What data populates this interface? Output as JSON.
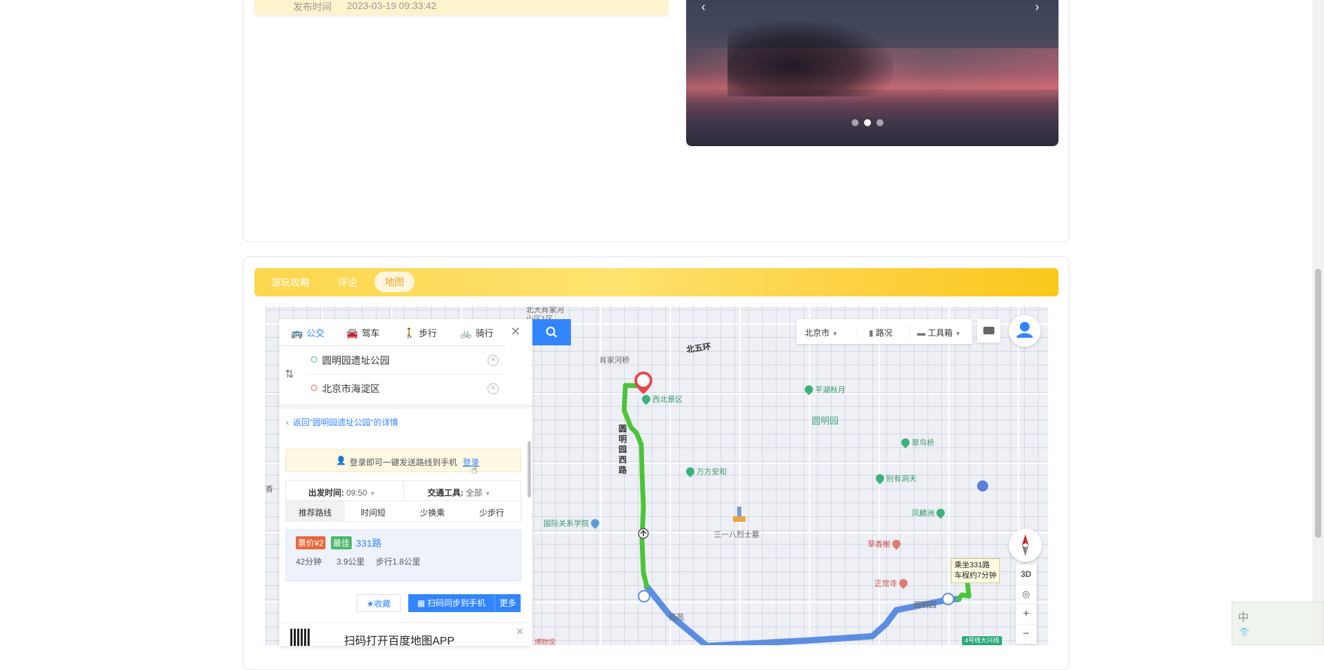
{
  "publish": {
    "label": "发布时间",
    "value": "2023-03-19 09:33:42"
  },
  "carousel": {
    "prev": "‹",
    "next": "›",
    "slide_count": 3,
    "active_slide": 2
  },
  "tabs": [
    {
      "label": "游玩攻略"
    },
    {
      "label": "评论"
    },
    {
      "label": "地图"
    }
  ],
  "active_tab": "地图",
  "map": {
    "modes": [
      {
        "label": "公交",
        "icon": "bus-icon"
      },
      {
        "label": "驾车",
        "icon": "car-icon"
      },
      {
        "label": "步行",
        "icon": "walk-icon"
      },
      {
        "label": "骑行",
        "icon": "bike-icon"
      }
    ],
    "active_mode": "公交",
    "start": "圆明园遗址公园",
    "end": "北京市海淀区",
    "back_link": "返回\"圆明园遗址公园\"的详情",
    "login_hint": "登录即可一键发送路线到手机",
    "login_link": "登录",
    "depart_label": "出发时间:",
    "depart_value": "09:50",
    "vehicle_label": "交通工具:",
    "vehicle_value": "全部",
    "sort_options": [
      "推荐路线",
      "时间短",
      "少换乘",
      "少步行"
    ],
    "plan": {
      "fare": "票价¥2",
      "best": "最佳",
      "route": "331路",
      "duration": "42分钟",
      "distance": "3.9公里",
      "walk": "步行1.8公里"
    },
    "favorite": "收藏",
    "sync": "扫码同步到手机",
    "more": "更多",
    "qr_ad": "扫码打开百度地图APP",
    "toolbar": {
      "city": "北京市",
      "traffic": "路况",
      "tools": "工具箱"
    },
    "zoom": {
      "three_d": "3D",
      "plus": "+",
      "minus": "−"
    },
    "end_marker": "终",
    "bus_tip_line1": "乘坐331路",
    "bus_tip_line2": "车程约7分钟",
    "labels": {
      "ring": "北五环",
      "xiaojiaheqiao": "肖家河桥",
      "beidajiao": "北大肖家河",
      "xiaoqu": "小区1区",
      "xibei": "西北景区",
      "pinghu": "平湖秋月",
      "yuanmingyuan": "圆明园",
      "cuiniao": "翠鸟桥",
      "wanfang": "万方安和",
      "biehe": "别有洞天",
      "fenglin": "凤麟洲",
      "guoji": "国际关系学院",
      "sanyiba": "三一八烈士墓",
      "caoxiang": "草香榭",
      "zhengjue": "正觉寺",
      "xiyuan": "西苑",
      "ymy_station": "圆明园",
      "line4": "4号线大兴线",
      "road_v": "圆明园西路",
      "museum": "博物馆",
      "xiang": "香"
    }
  }
}
